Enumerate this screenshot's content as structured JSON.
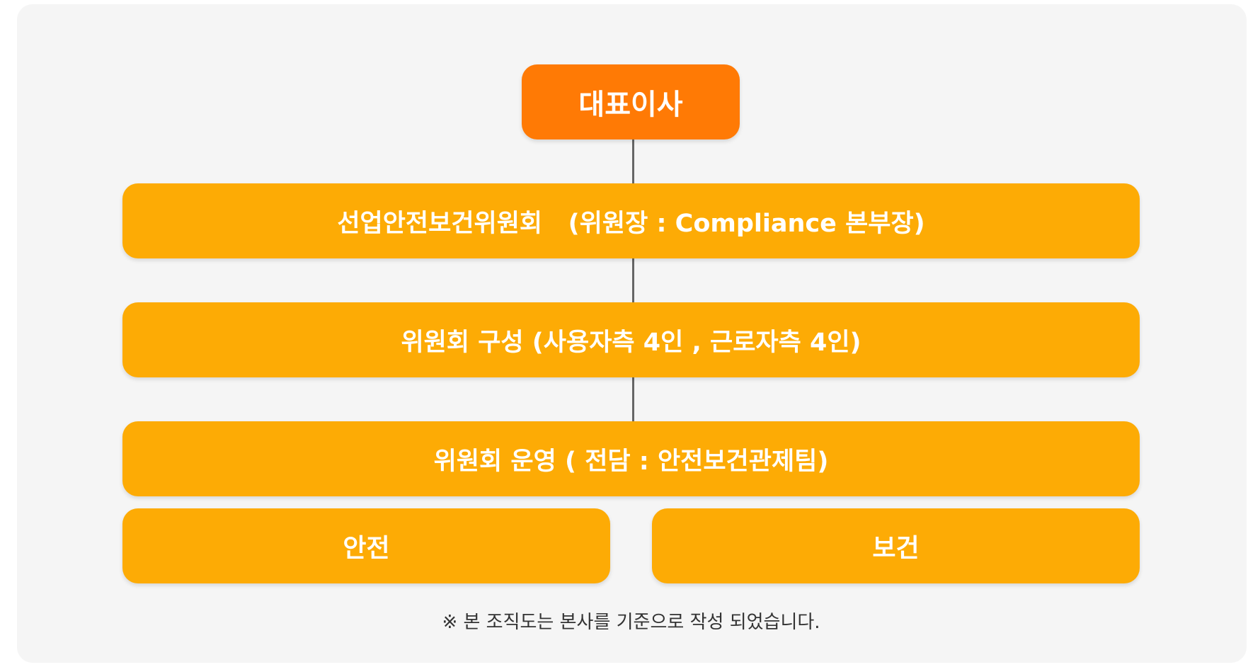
{
  "colors": {
    "ceo_box": "#ff7a05",
    "unit_box": "#fdab05",
    "connector": "#666666",
    "panel_background": "#f5f5f5",
    "box_text": "#ffffff"
  },
  "org_chart": {
    "top": "대표이사",
    "committee": "선업안전보건위원회   (위원장 : Compliance 본부장)",
    "composition": "위원회 구성 (사용자측 4인 , 근로자측 4인)",
    "operation": "위원회 운영 ( 전담 : 안전보건관제팀)",
    "branches": [
      {
        "label": "안전"
      },
      {
        "label": "보건"
      }
    ]
  },
  "footnote": "※ 본 조직도는 본사를 기준으로 작성 되었습니다."
}
